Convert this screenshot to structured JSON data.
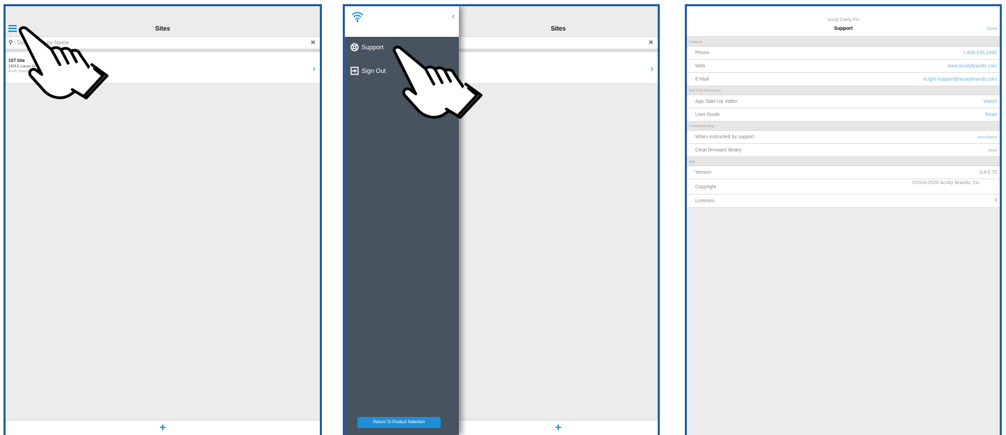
{
  "panel1": {
    "title": "Sites",
    "search_placeholder": "Search Site by Name",
    "site": {
      "name": "1ST Site",
      "address": "1405 E Locust St, Ontario CA, 91761 USA",
      "owner": "Acuity Brands"
    }
  },
  "panel2": {
    "title": "Sites",
    "menu": [
      {
        "label": "Support",
        "icon": "support-lifebuoy-icon"
      },
      {
        "label": "Sign Out",
        "icon": "sign-out-icon"
      }
    ],
    "return_button": "Return To Product Selection"
  },
  "panel3": {
    "app_name": "Acuity Clairty Pro",
    "title": "Support",
    "done": "Done",
    "sections": {
      "contacts": "Contacts",
      "selfhelp": "Self-Help Resources",
      "troubleshooting": "Troubleshooting",
      "app": "App"
    },
    "rows": {
      "phone": {
        "key": "Phone",
        "value": "1-800.535.2465"
      },
      "web": {
        "key": "Web",
        "value": "www.acuitybrands.com"
      },
      "email": {
        "key": "E-Mail",
        "value": "nLight-support@acuitybrands.com"
      },
      "video": {
        "key": "App Start-Up Video",
        "value": "Watch"
      },
      "guide": {
        "key": "User Guide",
        "value": "Read"
      },
      "report": {
        "key": "When instructed by support",
        "value": "Send Report"
      },
      "firmware": {
        "key": "Clear firmware library",
        "value": "Reset"
      },
      "version": {
        "key": "Version",
        "value": "3.4.0.79"
      },
      "copyright": {
        "key": "Copyright",
        "value": "©2016-2020 Acuity Brands, Inc."
      },
      "licenses": {
        "key": "Licenses",
        "value": ""
      }
    }
  },
  "colors": {
    "accent": "#1e8fd6",
    "frame": "#1f5fa8",
    "drawer": "#47535f"
  }
}
